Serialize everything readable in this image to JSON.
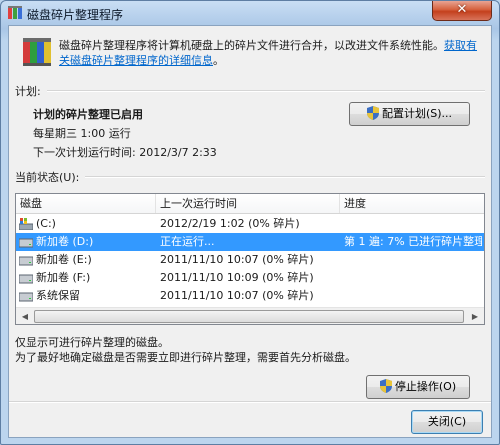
{
  "window": {
    "title": "磁盘碎片整理程序",
    "close_glyph": "✕"
  },
  "header": {
    "description": "磁盘碎片整理程序将计算机硬盘上的碎片文件进行合并，以改进文件系统性能。",
    "link": "获取有关磁盘碎片整理程序的详细信息",
    "link_suffix": "。"
  },
  "schedule": {
    "section_label": "计划:",
    "status": "计划的碎片整理已启用",
    "frequency": "每星期三 1:00 运行",
    "next_run": "下一次计划运行时间: 2012/3/7 2:33",
    "configure_button": "配置计划(S)..."
  },
  "current": {
    "section_label": "当前状态(U):",
    "columns": [
      "磁盘",
      "上一次运行时间",
      "进度"
    ],
    "rows": [
      {
        "disk": "(C:)",
        "last_run": "2012/2/19 1:02 (0% 碎片)",
        "progress": "",
        "icon": "system-drive-icon",
        "selected": false
      },
      {
        "disk": "新加卷 (D:)",
        "last_run": "正在运行...",
        "progress": "第 1 遍: 7% 已进行碎片整理",
        "icon": "drive-icon",
        "selected": true
      },
      {
        "disk": "新加卷 (E:)",
        "last_run": "2011/11/10 10:07 (0% 碎片)",
        "progress": "",
        "icon": "drive-icon",
        "selected": false
      },
      {
        "disk": "新加卷 (F:)",
        "last_run": "2011/11/10 10:09 (0% 碎片)",
        "progress": "",
        "icon": "drive-icon",
        "selected": false
      },
      {
        "disk": "系统保留",
        "last_run": "2011/11/10 10:07 (0% 碎片)",
        "progress": "",
        "icon": "drive-icon",
        "selected": false
      }
    ]
  },
  "notes": {
    "line1": "仅显示可进行碎片整理的磁盘。",
    "line2": "为了最好地确定磁盘是否需要立即进行碎片整理，需要首先分析磁盘。"
  },
  "buttons": {
    "stop": "停止操作(O)",
    "close": "关闭(C)"
  },
  "colors": {
    "selection": "#3399ff",
    "link": "#0066cc",
    "chrome": "#bcd5ee"
  }
}
